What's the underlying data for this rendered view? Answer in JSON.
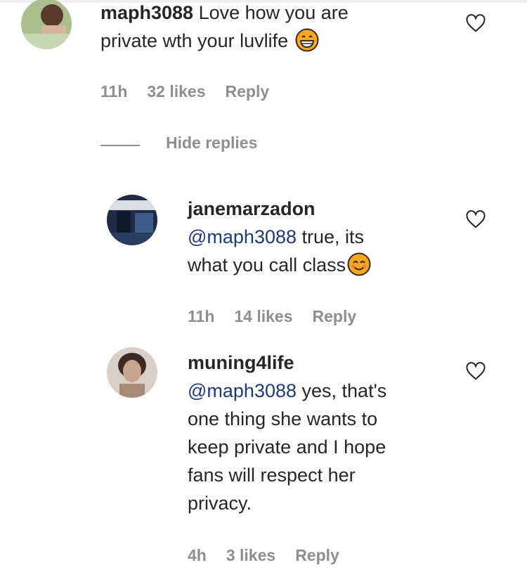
{
  "comment": {
    "username": "maph3088",
    "text_line1": "Love how you are",
    "text_line2": "private wth your luvlife",
    "emoji": "grinning-face-emoji",
    "time": "11h",
    "likes": "32 likes",
    "reply": "Reply"
  },
  "hide_replies_label": "Hide replies",
  "replies": [
    {
      "username": "janemarzadon",
      "mention": "@maph3088",
      "text_after_mention": " true, its",
      "text_line2": "what you call class",
      "emoji": "smiling-face-emoji",
      "time": "11h",
      "likes": "14 likes",
      "reply": "Reply"
    },
    {
      "username": "muning4life",
      "mention": "@maph3088",
      "text_after_mention": " yes, that's",
      "text_lines": [
        "one thing she wants to",
        "keep private and I hope",
        "fans will respect her",
        "privacy."
      ],
      "time": "4h",
      "likes": "3 likes",
      "reply": "Reply"
    }
  ],
  "colors": {
    "text": "#262626",
    "meta": "#8e8e8e",
    "mention": "#1e3a78",
    "emoji_fill": "#f5a623"
  }
}
